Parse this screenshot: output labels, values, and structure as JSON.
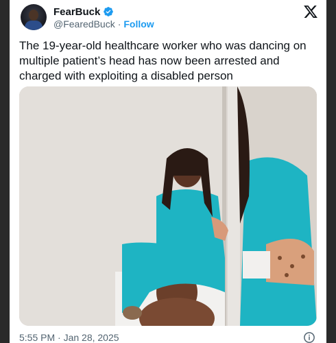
{
  "author": {
    "display_name": "FearBuck",
    "handle": "@FearedBuck",
    "follow_label": "Follow",
    "separator": "·",
    "verified": true
  },
  "tweet": {
    "text": "The 19-year-old healthcare worker who was dancing on multiple patient’s head has now been arrested and charged with exploiting a disabled person",
    "timestamp": "5:55 PM · Jan 28, 2025"
  },
  "icons": {
    "platform_logo": "x-logo-icon",
    "verified_badge": "verified-badge-icon",
    "info": "info-icon"
  },
  "colors": {
    "accent": "#1d9bf0",
    "text_primary": "#0f1419",
    "text_secondary": "#536471",
    "scrubs": "#1eb4c3"
  }
}
